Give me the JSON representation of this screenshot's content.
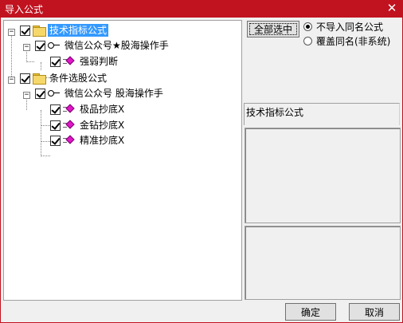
{
  "window": {
    "title": "导入公式",
    "close_glyph": "✕"
  },
  "tree": {
    "groups": [
      {
        "label": "技术指标公式",
        "checked": true,
        "selected": true,
        "children": [
          {
            "label": "微信公众号★股海操作手",
            "checked": true,
            "formulas": [
              "强弱判断"
            ]
          }
        ]
      },
      {
        "label": "条件选股公式",
        "checked": true,
        "selected": false,
        "children": [
          {
            "label": "微信公众号 股海操作手",
            "checked": true,
            "formulas": [
              "极品抄底X",
              "金钻抄底X",
              "精准抄底X"
            ]
          }
        ]
      }
    ]
  },
  "options": {
    "select_all_label": "全部选中",
    "radio": [
      {
        "label": "不导入同名公式",
        "checked": true
      },
      {
        "label": "覆盖同名(非系统)",
        "checked": false
      }
    ]
  },
  "info": {
    "caption": "技术指标公式"
  },
  "footer": {
    "ok_label": "确定",
    "cancel_label": "取消"
  }
}
